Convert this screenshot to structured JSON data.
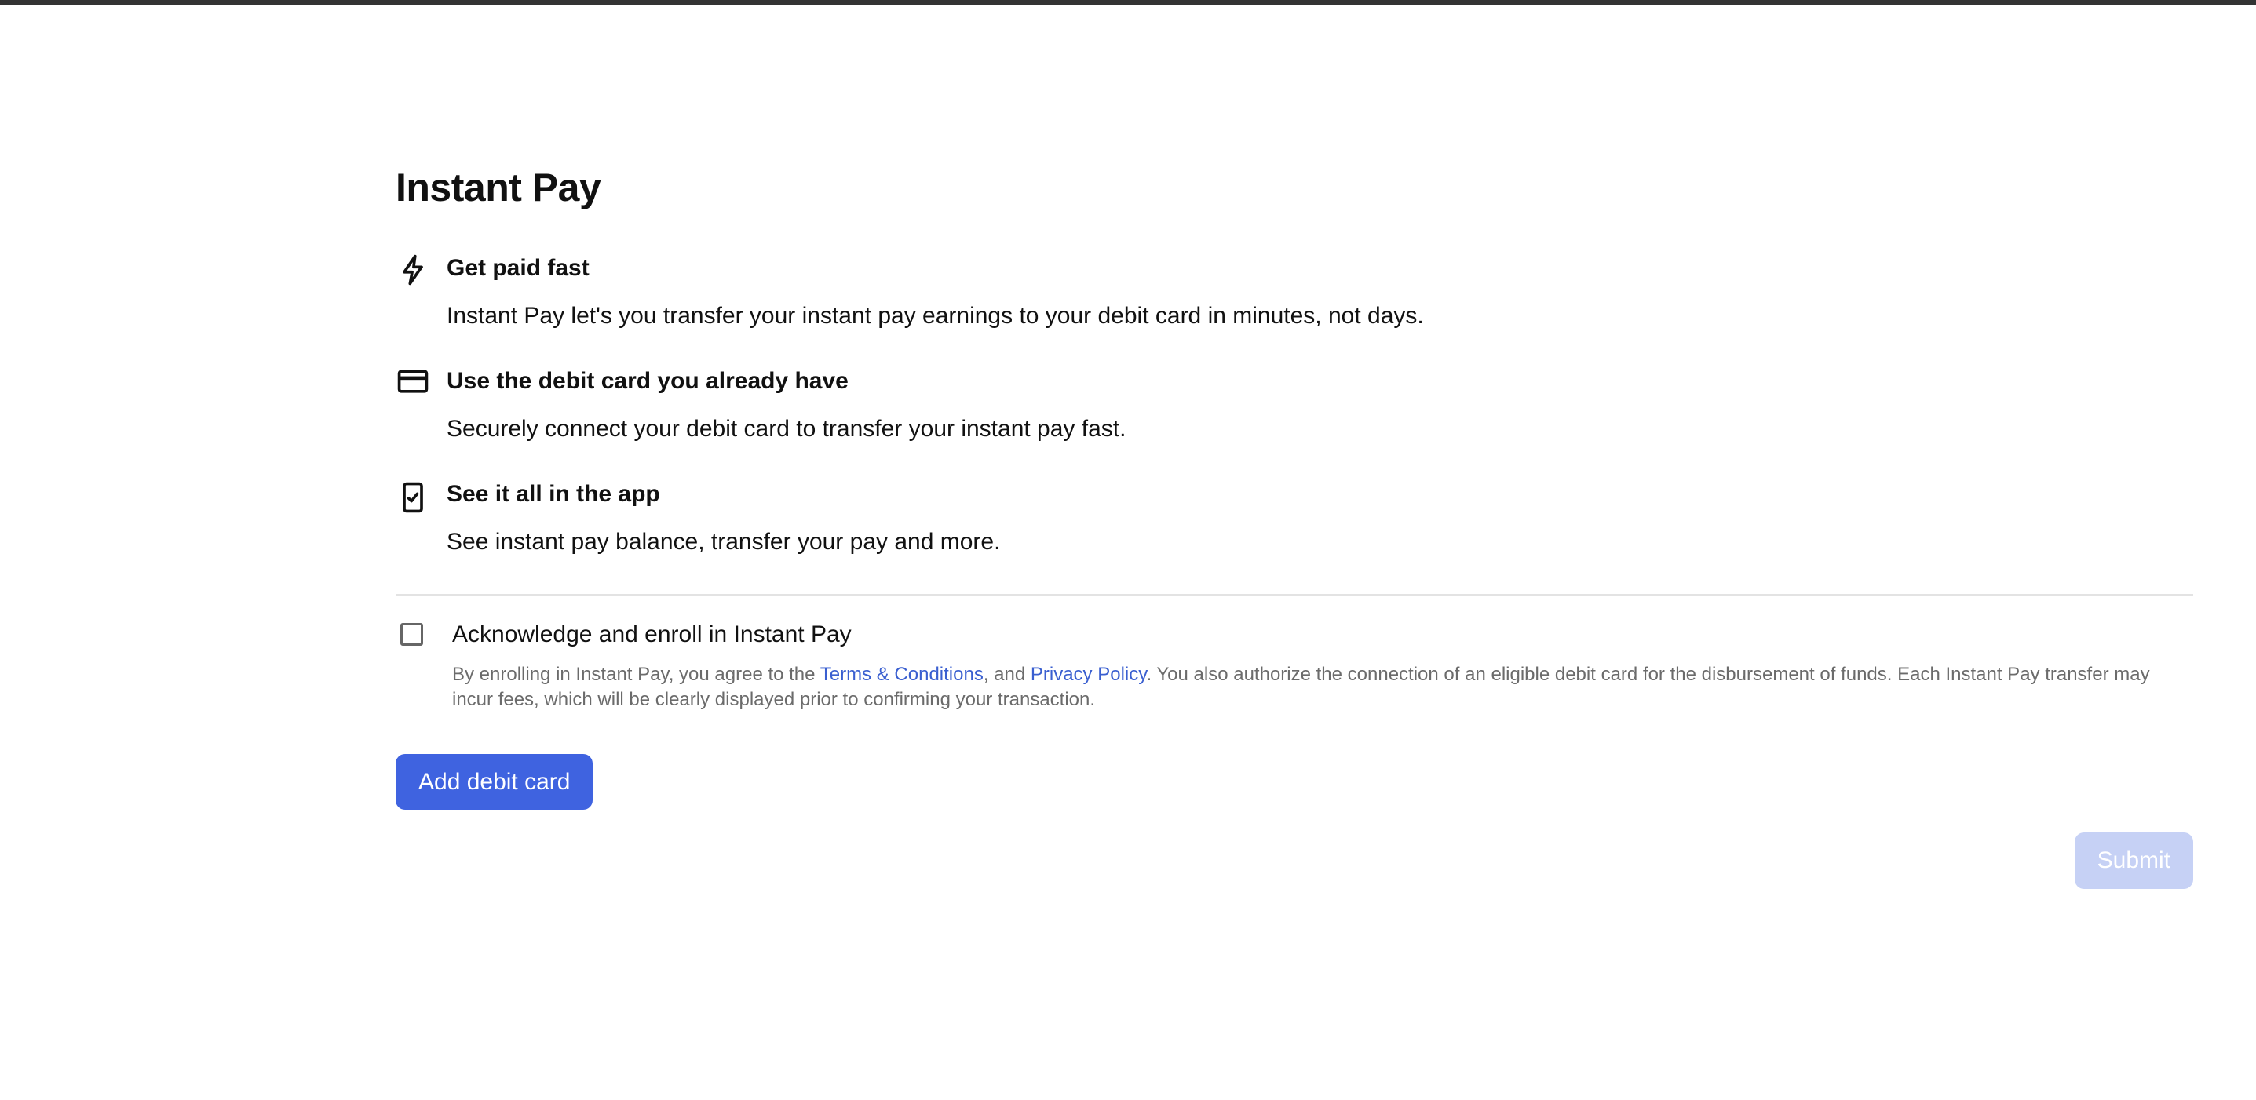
{
  "page": {
    "title": "Instant Pay"
  },
  "features": [
    {
      "icon": "lightning-bolt-icon",
      "title": "Get paid fast",
      "description": "Instant Pay let's you transfer your instant pay earnings to your debit card in minutes, not days."
    },
    {
      "icon": "credit-card-icon",
      "title": "Use the debit card you already have",
      "description": "Securely connect your debit card to transfer your instant pay fast."
    },
    {
      "icon": "phone-check-icon",
      "title": "See it all in the app",
      "description": "See instant pay balance, transfer your pay and more."
    }
  ],
  "acknowledge": {
    "label": "Acknowledge and enroll in Instant Pay",
    "checked": false,
    "legal_prefix": "By enrolling in Instant Pay, you agree to the ",
    "terms_link": "Terms & Conditions",
    "legal_middle": ", and ",
    "privacy_link": "Privacy Policy",
    "legal_suffix": ". You also authorize the connection of an eligible debit card for the disbursement of funds. Each Instant Pay transfer may incur fees, which will be clearly displayed prior to confirming your transaction."
  },
  "buttons": {
    "add_debit_card": "Add debit card",
    "submit": "Submit"
  },
  "colors": {
    "primary": "#3f63e0",
    "primary_disabled": "#c6d1f5",
    "link": "#3a5fd0",
    "muted_text": "#6b6b6b",
    "top_bar": "#333333"
  }
}
